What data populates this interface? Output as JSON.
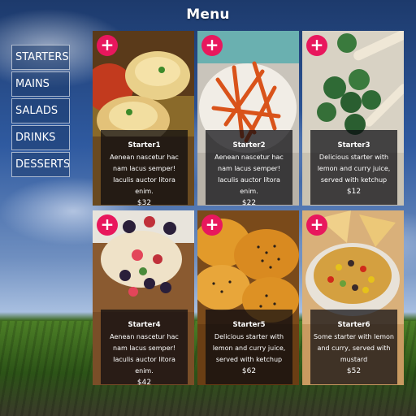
{
  "title": "Menu",
  "nav": [
    {
      "label": "STARTERS"
    },
    {
      "label": "MAINS"
    },
    {
      "label": "SALADS"
    },
    {
      "label": "DRINKS"
    },
    {
      "label": "DESSERTS"
    }
  ],
  "add_glyph": "+",
  "accent": "#e8175d",
  "items": [
    {
      "name": "Starter1",
      "desc": "Aenean nascetur hac nam lacus semper! Iaculis auctor litora enim.",
      "price": "$32"
    },
    {
      "name": "Starter2",
      "desc": "Aenean nascetur hac nam lacus semper! Iaculis auctor litora enim.",
      "price": "$22"
    },
    {
      "name": "Starter3",
      "desc": "Delicious starter with lemon and curry juice, served with ketchup",
      "price": "$12"
    },
    {
      "name": "Starter4",
      "desc": "Aenean nascetur hac nam lacus semper! Iaculis auctor litora enim.",
      "price": "$42"
    },
    {
      "name": "Starter5",
      "desc": "Delicious starter with lemon and curry juice, served with ketchup",
      "price": "$62"
    },
    {
      "name": "Starter6",
      "desc": "Some starter with lemon and curry, served with mustard",
      "price": "$52"
    }
  ]
}
